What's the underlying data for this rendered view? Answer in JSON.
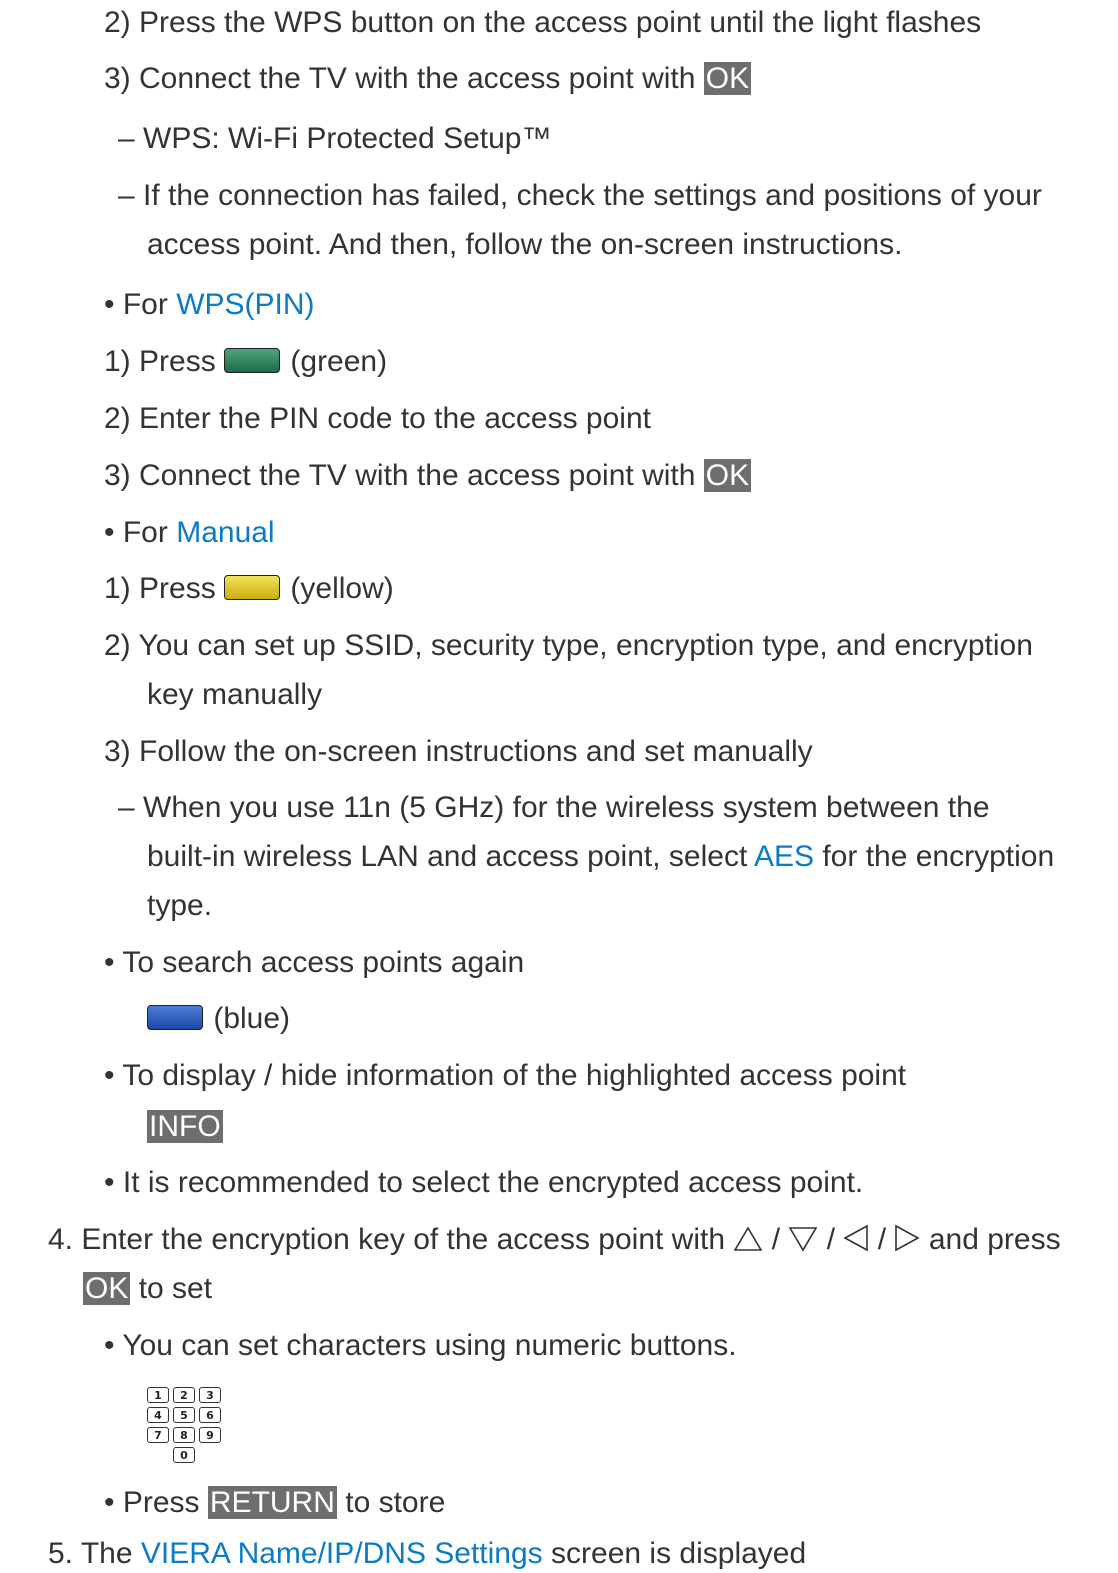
{
  "wps_push": {
    "step2": "2) Press the WPS button on the access point until the light flashes",
    "step3_prefix": "3) Connect the TV with the access point with",
    "step3_key": "OK",
    "note_wps": "– WPS: Wi-Fi Protected Setup™",
    "note_fail_1": "– If the connection has failed, check the settings and positions of your",
    "note_fail_2": "access point. And then, follow the on-screen instructions."
  },
  "wps_pin": {
    "bullet_prefix": "For",
    "link": "WPS(PIN)",
    "step1_prefix": "1) Press",
    "step1_suffix": "(green)",
    "step2": "2) Enter the PIN code to the access point",
    "step3_prefix": "3) Connect the TV with the access point with",
    "step3_key": "OK"
  },
  "manual": {
    "bullet_prefix": "For",
    "link": "Manual",
    "step1_prefix": "1) Press",
    "step1_suffix": "(yellow)",
    "step2_1": "2) You can set up SSID, security type, encryption type, and encryption",
    "step2_2": "key manually",
    "step3": "3) Follow the on-screen instructions and set manually",
    "note_1": "– When you use 11n (5 GHz) for the wireless system between the",
    "note_2_prefix": "built-in wireless LAN and access point, select",
    "note_2_link": "AES",
    "note_2_suffix": "for the encryption",
    "note_3": "type."
  },
  "search": {
    "bullet": "To search access points again",
    "suffix": "(blue)"
  },
  "info": {
    "bullet": "To display / hide information of the highlighted access point",
    "key": "INFO"
  },
  "recommend": "It is recommended to select the encrypted access point.",
  "step4": {
    "prefix": "4. Enter the encryption key of the access point with",
    "sep": "/",
    "suffix": "and press",
    "key": "OK",
    "key_suffix": "to set"
  },
  "numeric": {
    "bullet": "You can set characters using numeric buttons.",
    "keys": [
      "1",
      "2",
      "3",
      "4",
      "5",
      "6",
      "7",
      "8",
      "9",
      "0"
    ]
  },
  "return": {
    "prefix": "Press",
    "key": "RETURN",
    "suffix": "to store"
  },
  "step5": {
    "prefix": "5. The",
    "link": "VIERA Name/IP/DNS Settings",
    "suffix": "screen is displayed"
  },
  "colors": {
    "text": "#333333",
    "link": "#0a7ac9",
    "key_bg": "#6e6e6e"
  }
}
